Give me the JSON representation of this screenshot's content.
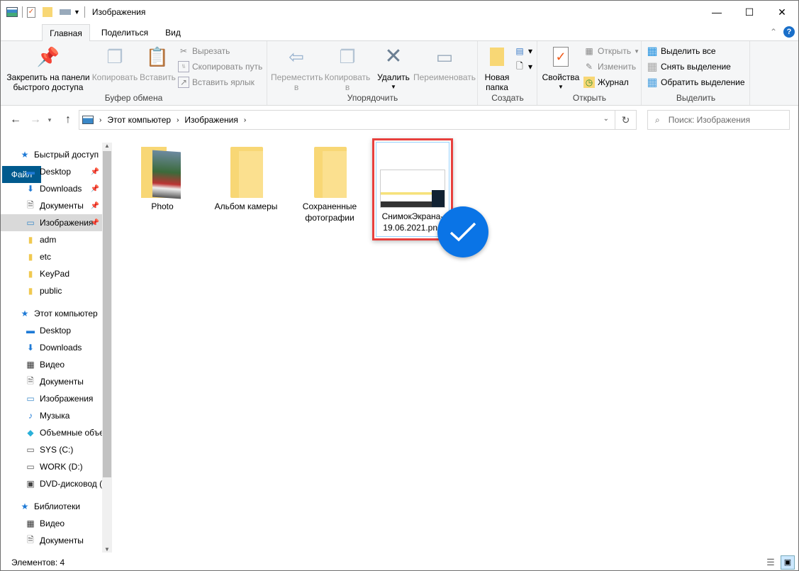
{
  "window": {
    "title": "Изображения",
    "minimize": "—",
    "maximize": "☐",
    "close": "✕"
  },
  "tabs": {
    "file": "Файл",
    "home": "Главная",
    "share": "Поделиться",
    "view": "Вид"
  },
  "ribbon": {
    "clipboard": {
      "label": "Буфер обмена",
      "pin": "Закрепить на панели быстрого доступа",
      "pin1": "Закрепить на панели",
      "pin2": "быстрого доступа",
      "copy": "Копировать",
      "paste": "Вставить",
      "cut": "Вырезать",
      "copy_path": "Скопировать путь",
      "paste_shortcut": "Вставить ярлык"
    },
    "organize": {
      "label": "Упорядочить",
      "move1": "Переместить",
      "move2": "в",
      "copy1": "Копировать",
      "copy2": "в",
      "delete": "Удалить",
      "rename": "Переименовать"
    },
    "new": {
      "label": "Создать",
      "new_folder1": "Новая",
      "new_folder2": "папка"
    },
    "open": {
      "label": "Открыть",
      "properties": "Свойства",
      "open": "Открыть",
      "edit": "Изменить",
      "history": "Журнал"
    },
    "select": {
      "label": "Выделить",
      "select_all": "Выделить все",
      "select_none": "Снять выделение",
      "invert": "Обратить выделение"
    }
  },
  "address": {
    "crumbs": [
      "Этот компьютер",
      "Изображения"
    ],
    "search_placeholder": "Поиск: Изображения"
  },
  "sidebar": {
    "quick_access": {
      "label": "Быстрый доступ",
      "items": [
        {
          "label": "Desktop",
          "icon": "desktop-icon",
          "pinned": true
        },
        {
          "label": "Downloads",
          "icon": "downloads-icon",
          "pinned": true
        },
        {
          "label": "Документы",
          "icon": "documents-icon",
          "pinned": true
        },
        {
          "label": "Изображения",
          "icon": "pictures-icon",
          "pinned": true,
          "selected": true
        },
        {
          "label": "adm",
          "icon": "shared-folder-icon"
        },
        {
          "label": "etc",
          "icon": "folder-icon"
        },
        {
          "label": "KeyPad",
          "icon": "folder-icon"
        },
        {
          "label": "public",
          "icon": "shared-folder-icon"
        }
      ]
    },
    "this_pc": {
      "label": "Этот компьютер",
      "items": [
        {
          "label": "Desktop",
          "icon": "desktop-icon"
        },
        {
          "label": "Downloads",
          "icon": "downloads-icon"
        },
        {
          "label": "Видео",
          "icon": "video-icon"
        },
        {
          "label": "Документы",
          "icon": "documents-icon"
        },
        {
          "label": "Изображения",
          "icon": "pictures-icon"
        },
        {
          "label": "Музыка",
          "icon": "music-icon"
        },
        {
          "label": "Объемные объекты",
          "icon": "3d-objects-icon"
        },
        {
          "label": "SYS (C:)",
          "icon": "drive-icon"
        },
        {
          "label": "WORK (D:)",
          "icon": "drive-icon"
        },
        {
          "label": "DVD-дисковод (",
          "icon": "dvd-icon"
        }
      ]
    },
    "libraries": {
      "label": "Библиотеки",
      "items": [
        {
          "label": "Видео",
          "icon": "video-icon"
        },
        {
          "label": "Документы",
          "icon": "documents-icon"
        }
      ]
    }
  },
  "files": [
    {
      "name1": "Photo",
      "name2": "",
      "type": "folder-with-photos"
    },
    {
      "name1": "Альбом камеры",
      "name2": "",
      "type": "folder"
    },
    {
      "name1": "Сохраненные",
      "name2": "фотографии",
      "type": "folder"
    },
    {
      "name1": "СнимокЭкрана-",
      "name2": "19.06.2021.png",
      "type": "image",
      "selected": true
    }
  ],
  "status": {
    "count": "Элементов: 4"
  },
  "colors": {
    "file_tab": "#005a8e",
    "selection_border": "#e8403d",
    "check_badge": "#0a74e6",
    "folder": "#f8d775"
  }
}
